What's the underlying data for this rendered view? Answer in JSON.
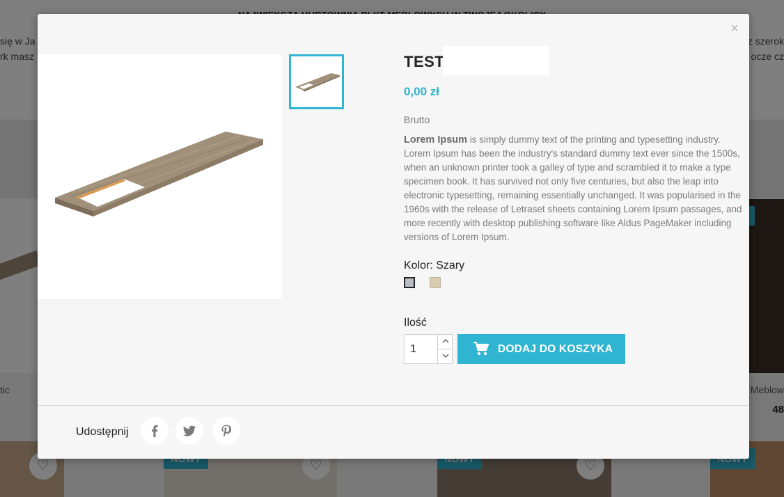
{
  "background": {
    "banner": "NAJWIĘKSZA HURTOWNIA PŁYT MEBLOWYCH W TWOJEJ OKOLICY",
    "left_text_lines": [
      "się w Ja",
      "rk masz"
    ],
    "right_text_lines": [
      "z szerok",
      "ocze cz"
    ],
    "left_caption": "tic",
    "right_caption": "a Meblow",
    "right_price": "48",
    "new_badge": "NOWY",
    "heart_icon": "heart-outline-icon"
  },
  "modal": {
    "close_label": "×",
    "title": "TEST",
    "price": "0,00 zł",
    "tax_label": "Brutto",
    "description_bold": "Lorem Ipsum",
    "description_rest": " is simply dummy text of the printing and typesetting industry. Lorem Ipsum has been the industry's standard dummy text ever since the 1500s, when an unknown printer took a galley of type and scrambled it to make a type specimen book. It has survived not only five centuries, but also the leap into electronic typesetting, remaining essentially unchanged. It was popularised in the 1960s with the release of Letraset sheets containing Lorem Ipsum passages, and more recently with desktop publishing software like Aldus PageMaker including versions of Lorem Ipsum.",
    "color_label": "Kolor: Szary",
    "colors": [
      {
        "name": "Szary",
        "hex": "#b7bec6",
        "selected": true
      },
      {
        "name": "Beż",
        "hex": "#d9ccb1",
        "selected": false
      }
    ],
    "quantity_label": "Ilość",
    "quantity_value": "1",
    "add_to_cart_label": "DODAJ DO KOSZYKA",
    "share_label": "Udostępnij",
    "social_icons": [
      "facebook-icon",
      "twitter-icon",
      "pinterest-icon"
    ],
    "accent_color": "#2fb5d2"
  }
}
